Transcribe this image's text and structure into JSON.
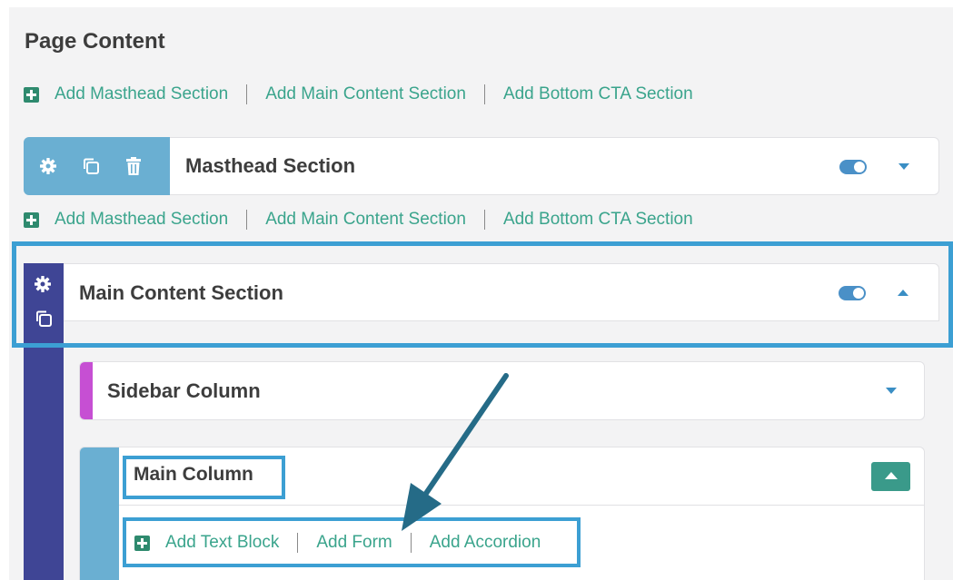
{
  "page": {
    "title": "Page Content"
  },
  "add_links": [
    "Add Masthead Section",
    "Add Main Content Section",
    "Add Bottom CTA Section"
  ],
  "masthead": {
    "title": "Masthead Section",
    "toggle_on": true
  },
  "main_content": {
    "title": "Main Content Section",
    "toggle_on": true
  },
  "sidebar_column": {
    "title": "Sidebar Column"
  },
  "main_column": {
    "title": "Main Column",
    "actions": [
      "Add Text Block",
      "Add Form",
      "Add Accordion"
    ]
  },
  "colors": {
    "accent_green": "#3aa48c",
    "tool_blue": "#6aafd2",
    "rail_indigo": "#3f4595",
    "sidebar_purple": "#c64fd3",
    "highlight_blue": "#3c9fd3",
    "arrow": "#256b87"
  },
  "icons": [
    "plus-square-icon",
    "gear-icon",
    "copy-icon",
    "trash-icon",
    "toggle-icon",
    "chevron-down-icon",
    "chevron-up-icon"
  ]
}
